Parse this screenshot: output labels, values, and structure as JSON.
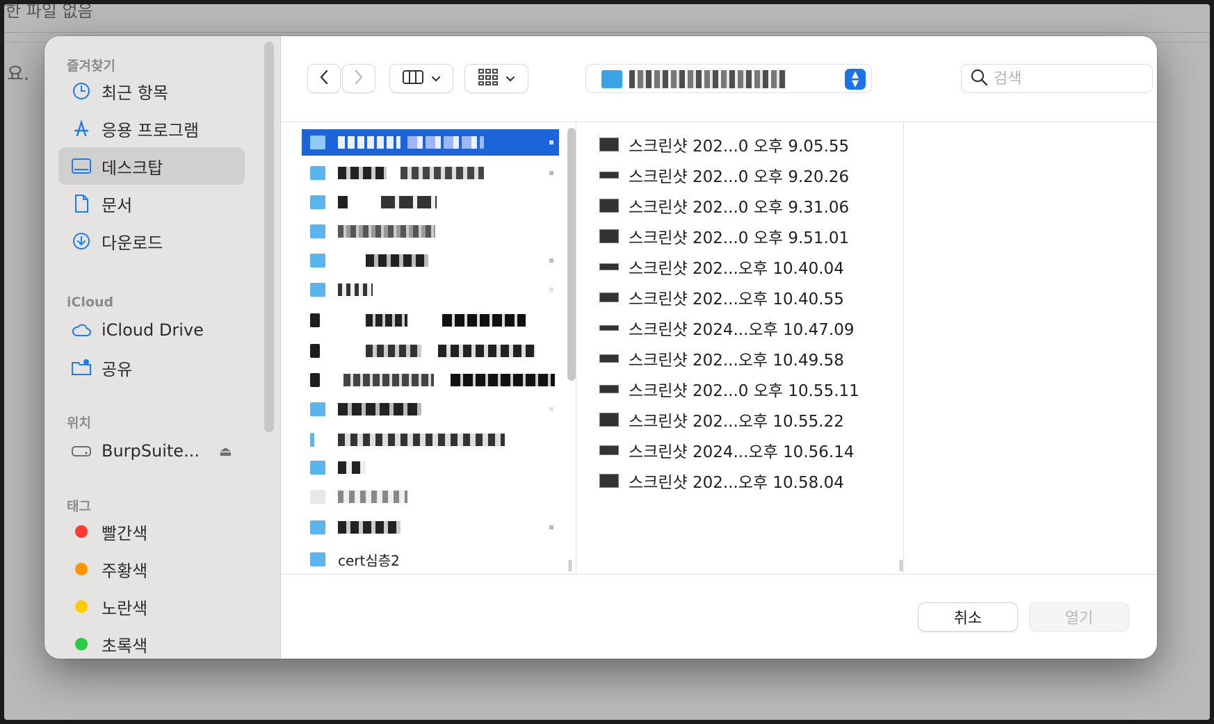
{
  "background": {
    "top_text": "한 파일 없음",
    "left_text": "요."
  },
  "sidebar": {
    "sections": [
      {
        "title": "즐겨찾기",
        "items": [
          {
            "label": "최근 항목",
            "icon": "clock-icon"
          },
          {
            "label": "응용 프로그램",
            "icon": "applications-icon"
          },
          {
            "label": "데스크탑",
            "icon": "desktop-icon",
            "selected": true
          },
          {
            "label": "문서",
            "icon": "document-icon"
          },
          {
            "label": "다운로드",
            "icon": "download-icon"
          }
        ]
      },
      {
        "title": "iCloud",
        "items": [
          {
            "label": "iCloud Drive",
            "icon": "cloud-icon"
          },
          {
            "label": "공유",
            "icon": "shared-folder-icon"
          }
        ]
      },
      {
        "title": "위치",
        "items": [
          {
            "label": "BurpSuite...",
            "icon": "disk-icon"
          }
        ]
      },
      {
        "title": "태그",
        "items": [
          {
            "label": "빨간색",
            "color": "#ff3b30"
          },
          {
            "label": "주황색",
            "color": "#ff9500"
          },
          {
            "label": "노란색",
            "color": "#ffcc00"
          },
          {
            "label": "초록색",
            "color": "#28cd41"
          }
        ]
      }
    ]
  },
  "toolbar": {
    "back_icon": "chevron-left-icon",
    "forward_icon": "chevron-right-icon",
    "view_icon": "columns-view-icon",
    "group_icon": "grid-group-icon",
    "search_placeholder": "검색"
  },
  "column1": {
    "last_visible_label": "cert심층2"
  },
  "files": [
    "스크린샷 202...0 오후 9.05.55",
    "스크린샷 202...0 오후 9.20.26",
    "스크린샷 202...0 오후 9.31.06",
    "스크린샷 202...0 오후 9.51.01",
    "스크린샷 202...오후 10.40.04",
    "스크린샷 202...오후 10.40.55",
    "스크린샷 2024...오후 10.47.09",
    "스크린샷 202...오후 10.49.58",
    "스크린샷 202...0 오후 10.55.11",
    "스크린샷 202...오후 10.55.22",
    "스크린샷 2024...오후 10.56.14",
    "스크린샷 202...오후 10.58.04"
  ],
  "buttons": {
    "cancel": "취소",
    "open": "열기"
  },
  "colors": {
    "accent": "#1b64da",
    "folder": "#5bb4ee"
  }
}
